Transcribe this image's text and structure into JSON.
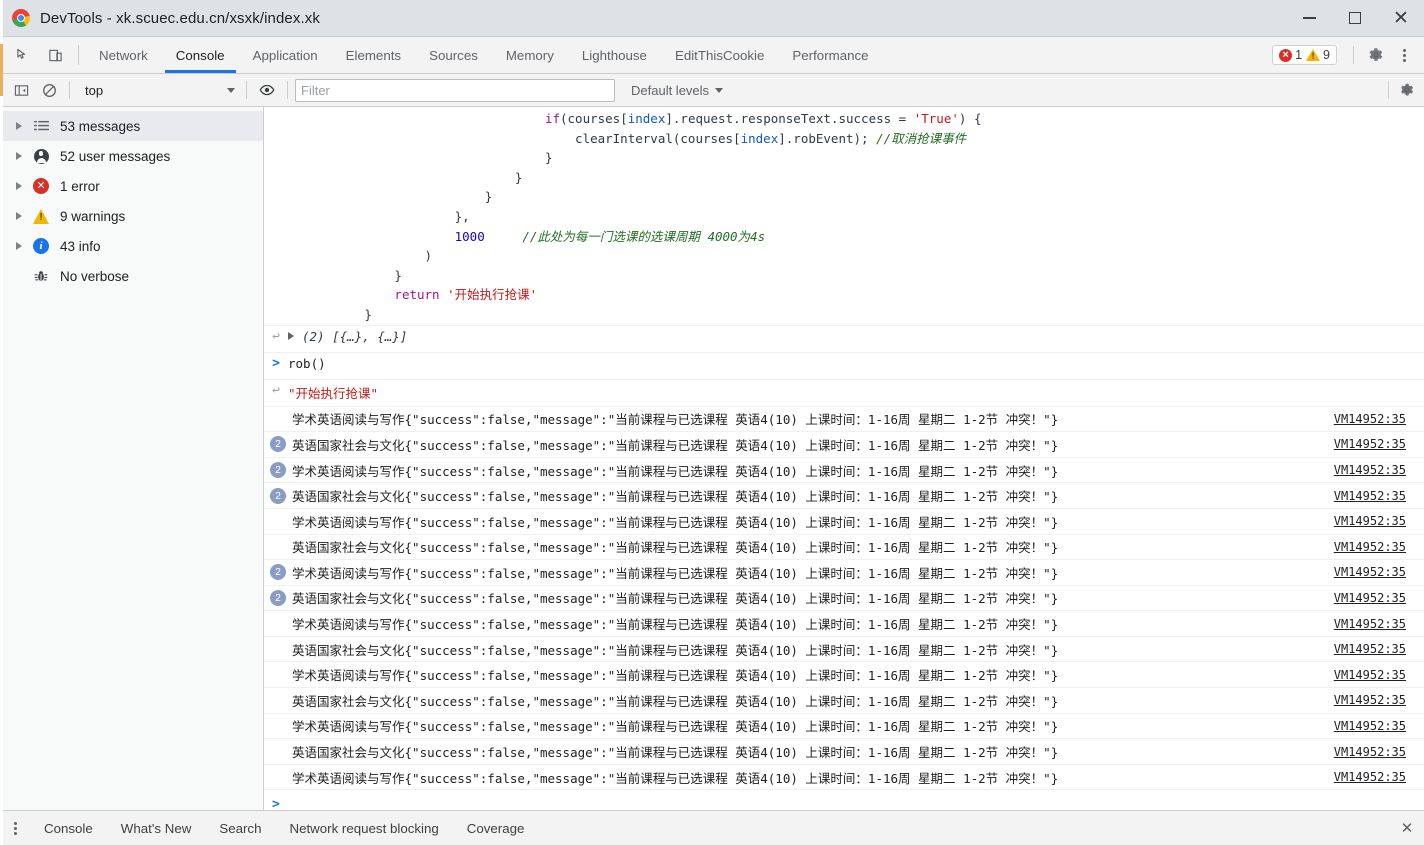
{
  "window": {
    "title": "DevTools - xk.scuec.edu.cn/xsxk/index.xk",
    "minimize_label": "Minimize",
    "maximize_label": "Maximize",
    "close_label": "Close"
  },
  "tabstrip": {
    "inspect_icon": "inspect-element-icon",
    "device_icon": "device-toolbar-icon",
    "tabs": [
      {
        "label": "Network",
        "active": false
      },
      {
        "label": "Console",
        "active": true
      },
      {
        "label": "Application",
        "active": false
      },
      {
        "label": "Elements",
        "active": false
      },
      {
        "label": "Sources",
        "active": false
      },
      {
        "label": "Memory",
        "active": false
      },
      {
        "label": "Lighthouse",
        "active": false
      },
      {
        "label": "EditThisCookie",
        "active": false
      },
      {
        "label": "Performance",
        "active": false
      }
    ],
    "counters": {
      "errors": "1",
      "warnings": "9"
    },
    "settings_icon": "gear-icon",
    "more_icon": "kebab-menu-icon"
  },
  "filterbar": {
    "sidebar_toggle_icon": "show-console-sidebar-icon",
    "clear_icon": "clear-console-icon",
    "context_value": "top",
    "eye_icon": "live-expression-icon",
    "filter_placeholder": "Filter",
    "filter_value": "",
    "levels_label": "Default levels",
    "settings_icon": "console-settings-gear-icon"
  },
  "sidebar": {
    "items": [
      {
        "label": "53 messages",
        "icon": "list-icon",
        "selected": true,
        "expandable": true
      },
      {
        "label": "52 user messages",
        "icon": "user-icon",
        "selected": false,
        "expandable": true
      },
      {
        "label": "1 error",
        "icon": "error-icon",
        "selected": false,
        "expandable": true
      },
      {
        "label": "9 warnings",
        "icon": "warning-icon",
        "selected": false,
        "expandable": true
      },
      {
        "label": "43 info",
        "icon": "info-icon",
        "selected": false,
        "expandable": true
      },
      {
        "label": "No verbose",
        "icon": "bug-icon",
        "selected": false,
        "expandable": false
      }
    ]
  },
  "console": {
    "code_lines": [
      {
        "indent": 36,
        "parts": [
          {
            "t": "if",
            "c": "kw"
          },
          {
            "t": "(courses[",
            "c": "plain"
          },
          {
            "t": "index",
            "c": "prop"
          },
          {
            "t": "].request.responseText.success ",
            "c": "plain"
          },
          {
            "t": "= ",
            "c": "plain"
          },
          {
            "t": "'True'",
            "c": "str"
          },
          {
            "t": ") {",
            "c": "plain"
          }
        ]
      },
      {
        "indent": 40,
        "parts": [
          {
            "t": "clearInterval(courses[",
            "c": "plain"
          },
          {
            "t": "index",
            "c": "prop"
          },
          {
            "t": "].robEvent); ",
            "c": "plain"
          },
          {
            "t": "//取消抢课事件",
            "c": "cmt"
          }
        ]
      },
      {
        "indent": 36,
        "parts": [
          {
            "t": "}",
            "c": "plain"
          }
        ]
      },
      {
        "indent": 32,
        "parts": [
          {
            "t": "}",
            "c": "plain"
          }
        ]
      },
      {
        "indent": 28,
        "parts": [
          {
            "t": "}",
            "c": "plain"
          }
        ]
      },
      {
        "indent": 24,
        "parts": [
          {
            "t": "},",
            "c": "plain"
          }
        ]
      },
      {
        "indent": 24,
        "parts": [
          {
            "t": "1000",
            "c": "num"
          },
          {
            "t": "     ",
            "c": "plain"
          },
          {
            "t": "//此处为每一门选课的选课周期 4000为4s",
            "c": "cmt"
          }
        ]
      },
      {
        "indent": 20,
        "parts": [
          {
            "t": ")",
            "c": "plain"
          }
        ]
      },
      {
        "indent": 16,
        "parts": [
          {
            "t": "}",
            "c": "plain"
          }
        ]
      },
      {
        "indent": 16,
        "parts": [
          {
            "t": "return ",
            "c": "kw"
          },
          {
            "t": "'开始执行抢课'",
            "c": "str"
          }
        ]
      },
      {
        "indent": 12,
        "parts": [
          {
            "t": "}",
            "c": "plain"
          }
        ]
      }
    ],
    "array_result": "(2) [{…}, {…}]",
    "input_expression": "rob()",
    "string_result": "\"开始执行抢课\"",
    "source_link": "VM14952:35",
    "messages": [
      {
        "badge": "",
        "course": "学术英语阅读与写作",
        "payload": "{\"success\":false,\"message\":\"当前课程与已选课程 英语4(10) 上课时间：1-16周 星期二 1-2节 冲突！\"}"
      },
      {
        "badge": "2",
        "course": "英语国家社会与文化",
        "payload": "{\"success\":false,\"message\":\"当前课程与已选课程 英语4(10) 上课时间：1-16周 星期二 1-2节 冲突！\"}"
      },
      {
        "badge": "2",
        "course": "学术英语阅读与写作",
        "payload": "{\"success\":false,\"message\":\"当前课程与已选课程 英语4(10) 上课时间：1-16周 星期二 1-2节 冲突！\"}"
      },
      {
        "badge": "2",
        "course": "英语国家社会与文化",
        "payload": "{\"success\":false,\"message\":\"当前课程与已选课程 英语4(10) 上课时间：1-16周 星期二 1-2节 冲突！\"}"
      },
      {
        "badge": "",
        "course": "学术英语阅读与写作",
        "payload": "{\"success\":false,\"message\":\"当前课程与已选课程 英语4(10) 上课时间：1-16周 星期二 1-2节 冲突！\"}"
      },
      {
        "badge": "",
        "course": "英语国家社会与文化",
        "payload": "{\"success\":false,\"message\":\"当前课程与已选课程 英语4(10) 上课时间：1-16周 星期二 1-2节 冲突！\"}"
      },
      {
        "badge": "2",
        "course": "学术英语阅读与写作",
        "payload": "{\"success\":false,\"message\":\"当前课程与已选课程 英语4(10) 上课时间：1-16周 星期二 1-2节 冲突！\"}"
      },
      {
        "badge": "2",
        "course": "英语国家社会与文化",
        "payload": "{\"success\":false,\"message\":\"当前课程与已选课程 英语4(10) 上课时间：1-16周 星期二 1-2节 冲突！\"}"
      },
      {
        "badge": "",
        "course": "学术英语阅读与写作",
        "payload": "{\"success\":false,\"message\":\"当前课程与已选课程 英语4(10) 上课时间：1-16周 星期二 1-2节 冲突！\"}"
      },
      {
        "badge": "",
        "course": "英语国家社会与文化",
        "payload": "{\"success\":false,\"message\":\"当前课程与已选课程 英语4(10) 上课时间：1-16周 星期二 1-2节 冲突！\"}"
      },
      {
        "badge": "",
        "course": "学术英语阅读与写作",
        "payload": "{\"success\":false,\"message\":\"当前课程与已选课程 英语4(10) 上课时间：1-16周 星期二 1-2节 冲突！\"}"
      },
      {
        "badge": "",
        "course": "英语国家社会与文化",
        "payload": "{\"success\":false,\"message\":\"当前课程与已选课程 英语4(10) 上课时间：1-16周 星期二 1-2节 冲突！\"}"
      },
      {
        "badge": "",
        "course": "学术英语阅读与写作",
        "payload": "{\"success\":false,\"message\":\"当前课程与已选课程 英语4(10) 上课时间：1-16周 星期二 1-2节 冲突！\"}"
      },
      {
        "badge": "",
        "course": "英语国家社会与文化",
        "payload": "{\"success\":false,\"message\":\"当前课程与已选课程 英语4(10) 上课时间：1-16周 星期二 1-2节 冲突！\"}"
      },
      {
        "badge": "",
        "course": "学术英语阅读与写作",
        "payload": "{\"success\":false,\"message\":\"当前课程与已选课程 英语4(10) 上课时间：1-16周 星期二 1-2节 冲突！\"}"
      }
    ],
    "prompt_caret": ">"
  },
  "drawer": {
    "more_icon": "kebab-menu-icon",
    "tabs": [
      "Console",
      "What's New",
      "Search",
      "Network request blocking",
      "Coverage"
    ],
    "close_label": "✕"
  },
  "colors": {
    "accent": "#1a73e8",
    "error": "#d93025",
    "warning": "#f2b600",
    "info": "#1a73e8",
    "badge": "#8a9cc1",
    "comment": "#236e25",
    "string": "#c41a16",
    "keyword": "#aa0d91",
    "number": "#1c00cf"
  }
}
